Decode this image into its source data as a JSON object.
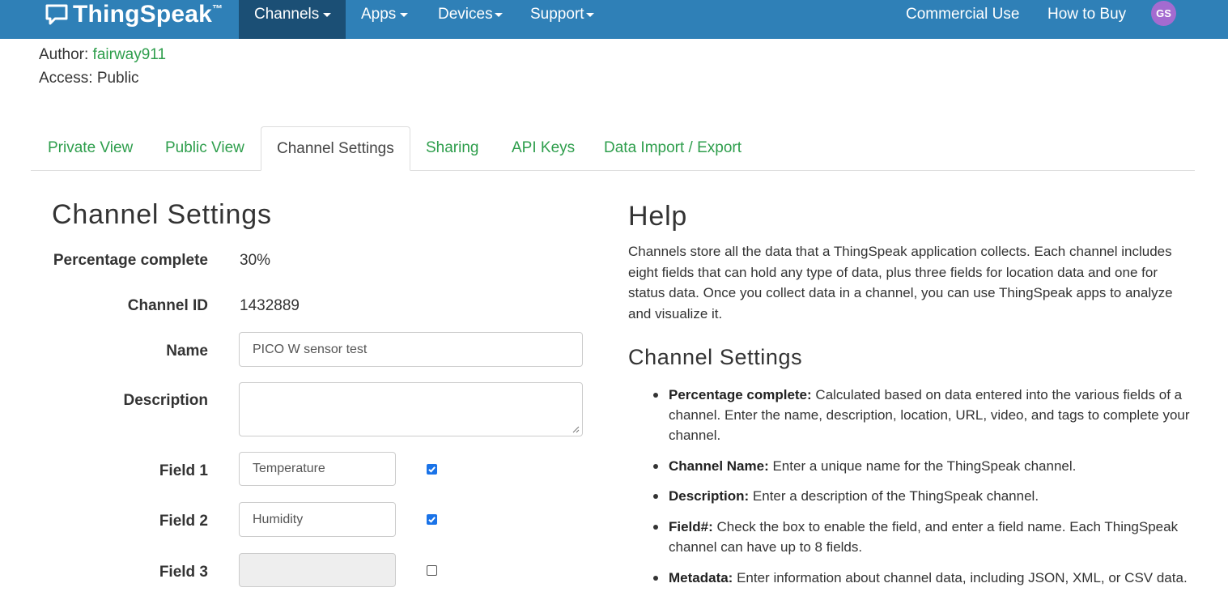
{
  "navbar": {
    "logo_text": "ThingSpeak",
    "logo_tm": "™",
    "menu": [
      {
        "label": "Channels",
        "active": true
      },
      {
        "label": "Apps",
        "active": false
      },
      {
        "label": "Devices",
        "active": false
      },
      {
        "label": "Support",
        "active": false
      }
    ],
    "right_links": [
      "Commercial Use",
      "How to Buy"
    ],
    "avatar_initials": "GS"
  },
  "channel_meta": {
    "author_label": "Author:",
    "author_value": "fairway911",
    "access_label": "Access:",
    "access_value": "Public"
  },
  "tabs": [
    {
      "label": "Private View",
      "active": false
    },
    {
      "label": "Public View",
      "active": false
    },
    {
      "label": "Channel Settings",
      "active": true
    },
    {
      "label": "Sharing",
      "active": false
    },
    {
      "label": "API Keys",
      "active": false
    },
    {
      "label": "Data Import / Export",
      "active": false
    }
  ],
  "settings": {
    "heading": "Channel Settings",
    "percentage_label": "Percentage complete",
    "percentage_value": "30%",
    "channel_id_label": "Channel ID",
    "channel_id_value": "1432889",
    "name_label": "Name",
    "name_value": "PICO W sensor test",
    "description_label": "Description",
    "description_value": "",
    "fields": [
      {
        "label": "Field 1",
        "value": "Temperature",
        "enabled": true
      },
      {
        "label": "Field 2",
        "value": "Humidity",
        "enabled": true
      },
      {
        "label": "Field 3",
        "value": "",
        "enabled": false
      }
    ]
  },
  "help": {
    "heading": "Help",
    "intro": "Channels store all the data that a ThingSpeak application collects. Each channel includes eight fields that can hold any type of data, plus three fields for location data and one for status data. Once you collect data in a channel, you can use ThingSpeak apps to analyze and visualize it.",
    "subheading": "Channel Settings",
    "items": [
      {
        "term": "Percentage complete:",
        "text": " Calculated based on data entered into the various fields of a channel. Enter the name, description, location, URL, video, and tags to complete your channel."
      },
      {
        "term": "Channel Name:",
        "text": " Enter a unique name for the ThingSpeak channel."
      },
      {
        "term": "Description:",
        "text": " Enter a description of the ThingSpeak channel."
      },
      {
        "term": "Field#:",
        "text": " Check the box to enable the field, and enter a field name. Each ThingSpeak channel can have up to 8 fields."
      },
      {
        "term": "Metadata:",
        "text": " Enter information about channel data, including JSON, XML, or CSV data."
      }
    ]
  },
  "colors": {
    "navbar": "#2f80b7",
    "navbar_active": "#1b4f75",
    "link_green": "#2e9e4c",
    "avatar": "#a46bd0",
    "checkbox": "#1a73e8"
  }
}
